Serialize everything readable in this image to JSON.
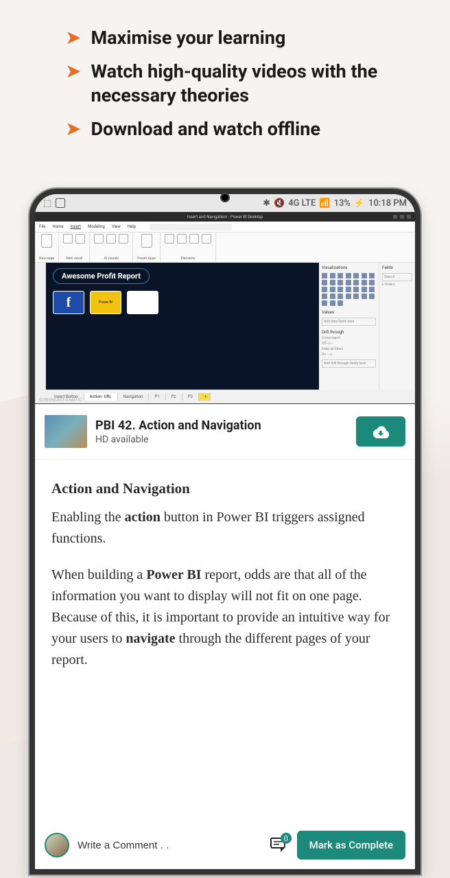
{
  "bullets": [
    "Maximise your learning",
    "Watch high-quality videos with the necessary theories",
    "Download and watch offline"
  ],
  "status_bar": {
    "signal": "4G LTE",
    "battery": "13%",
    "time": "10:18 PM"
  },
  "pbi": {
    "window_title": "Insert and Navigation! - Power BI Desktop",
    "ribbon_tabs": [
      "File",
      "Home",
      "Insert",
      "Modeling",
      "View",
      "Help"
    ],
    "active_tab": "Insert",
    "search_placeholder": "Search",
    "report_title": "Awesome Profit Report",
    "card_yellow_label": "Power BI",
    "panel_viz": "Visualizations",
    "panel_fields": "Fields",
    "fields_search": "Search",
    "fields_item": "Orders",
    "values_label": "Values",
    "values_placeholder": "Add data fields here",
    "drill_label": "Drill through",
    "crossreport": "Cross-report",
    "crossreport_state": "Off",
    "keepfilters": "Keep all filters",
    "keepfilters_state": "On",
    "drill_placeholder": "Add drill-through fields here",
    "page_tabs": [
      "Insert Button",
      "Action- URL",
      "Navigation",
      "P1",
      "P2",
      "P3"
    ],
    "active_page": "Action- URL",
    "watermark": "SCREENCAST-O-MATIC"
  },
  "lesson": {
    "title": "PBI 42. Action and Navigation",
    "subtitle": "HD available"
  },
  "content": {
    "heading": "Action and Navigation",
    "p1_pre": "Enabling the ",
    "p1_b1": "action",
    "p1_post": " button in Power BI triggers assigned functions.",
    "p2_pre": "When building a ",
    "p2_b1": "Power BI",
    "p2_mid": " report, odds are that all of the information you want to display will not fit on one page. Because of this, it is important to provide an intuitive way for your users to ",
    "p2_b2": "navigate",
    "p2_post": " through the different pages of your report."
  },
  "bottom": {
    "comment_placeholder": "Write a Comment . .",
    "comment_count": "0",
    "mark_complete": "Mark as Complete"
  }
}
